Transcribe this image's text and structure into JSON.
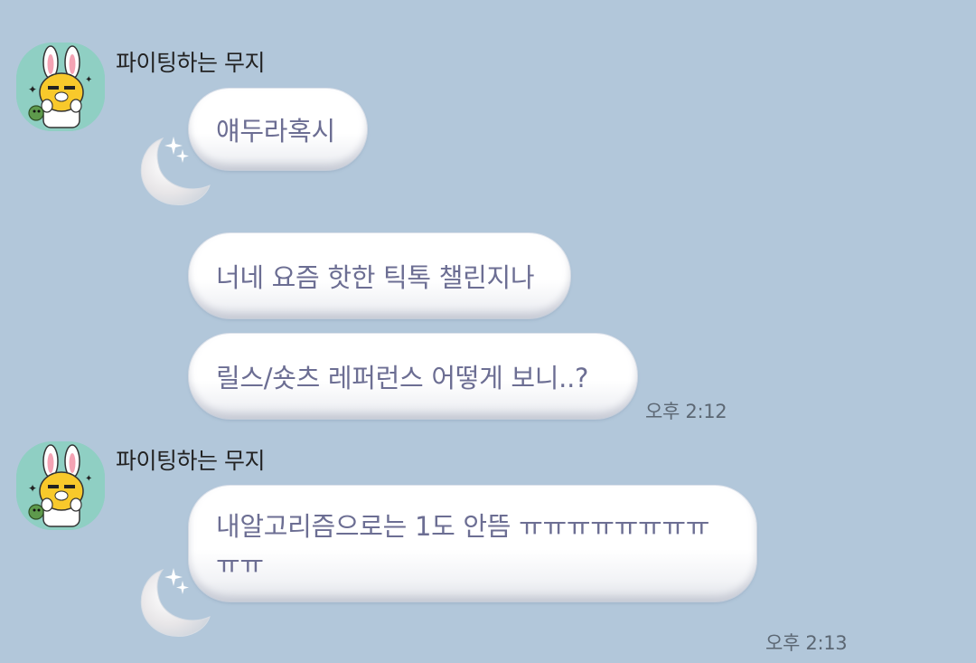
{
  "chat": {
    "groups": [
      {
        "sender": "파이팅하는 무지",
        "messages": [
          "얘두라혹시",
          "너네 요즘 핫한 틱톡 챌린지나",
          "릴스/숏츠 레퍼런스 어떻게 보니..?"
        ],
        "time": "오후 2:12"
      },
      {
        "sender": "파이팅하는 무지",
        "messages": [
          "내알고리즘으로는 1도 안뜸 ㅠㅠㅠㅠㅠㅠㅠㅠㅠㅠ"
        ],
        "time": "오후 2:13"
      }
    ]
  },
  "icons": {
    "avatar": "muzi-rabbit-avatar-icon",
    "bubble_decoration": "crescent-moon-sparkle-icon"
  },
  "colors": {
    "background": "#b2c7da",
    "bubble_text": "#6c6e93",
    "avatar_bg": "#8fcfc3"
  }
}
